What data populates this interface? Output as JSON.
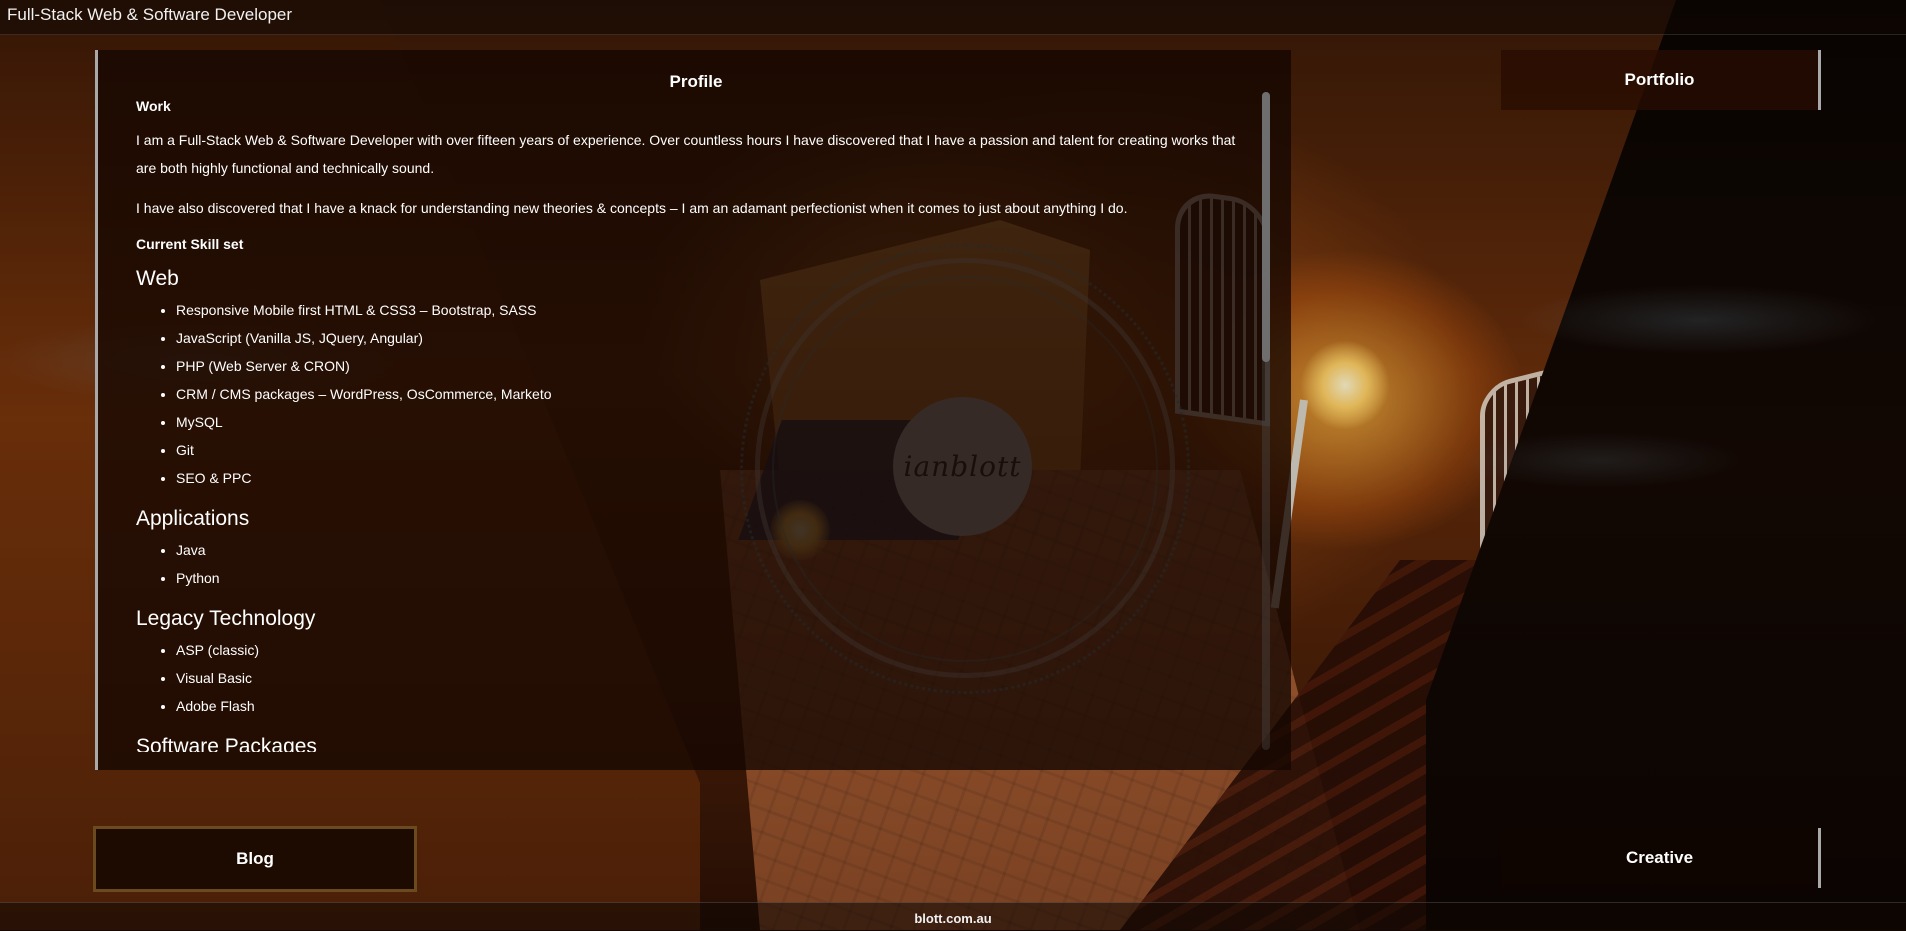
{
  "header": {
    "title": "Full-Stack Web & Software Developer"
  },
  "logo": {
    "text": "ianblott"
  },
  "profile": {
    "title": "Profile",
    "work_heading": "Work",
    "paragraphs": [
      "I am a Full-Stack Web & Software Developer with over fifteen years of experience. Over countless hours I have discovered that I have a passion and talent for creating works that are both highly functional and technically sound.",
      "I have also discovered that I have a knack for understanding new theories & concepts – I am an adamant perfectionist when it comes to just about anything I do."
    ],
    "skill_heading": "Current Skill set",
    "sections": [
      {
        "title": "Web",
        "items": [
          "Responsive Mobile first HTML & CSS3 – Bootstrap, SASS",
          "JavaScript (Vanilla JS, JQuery, Angular)",
          "PHP (Web Server & CRON)",
          "CRM / CMS packages – WordPress, OsCommerce, Marketo",
          "MySQL",
          "Git",
          "SEO & PPC"
        ]
      },
      {
        "title": "Applications",
        "items": [
          "Java",
          "Python"
        ]
      },
      {
        "title": "Legacy Technology",
        "items": [
          "ASP (classic)",
          "Visual Basic",
          "Adobe Flash"
        ]
      },
      {
        "title": "Software Packages",
        "items": []
      }
    ]
  },
  "nav": {
    "portfolio": "Portfolio",
    "blog": "Blog",
    "creative": "Creative"
  },
  "footer": {
    "text": "blott.com.au"
  }
}
